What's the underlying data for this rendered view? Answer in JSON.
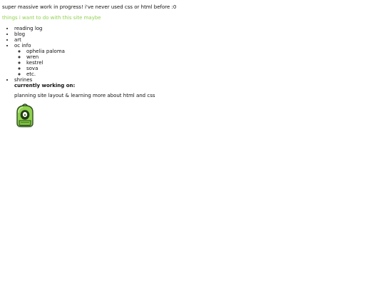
{
  "intro": {
    "text": "super massive work in progress! i've never used css or html before :0"
  },
  "goals": {
    "heading": "things i want to do with this site maybe",
    "color": "#8fd14f"
  },
  "nav": {
    "items": [
      {
        "label": "reading log"
      },
      {
        "label": "blog"
      },
      {
        "label": "art"
      },
      {
        "label": "oc info",
        "children": [
          {
            "label": "ophelia paloma"
          },
          {
            "label": "wren"
          },
          {
            "label": "kestrel"
          },
          {
            "label": "sova"
          },
          {
            "label": "etc."
          }
        ]
      },
      {
        "label": "shrines"
      }
    ]
  },
  "current": {
    "heading": "currently working on:",
    "text": "planning site layout & learning more about html and css"
  },
  "mascot": {
    "icon": "green-backpack-icon",
    "body_color": "#8fd14f",
    "outline_color": "#2f4f1f"
  }
}
